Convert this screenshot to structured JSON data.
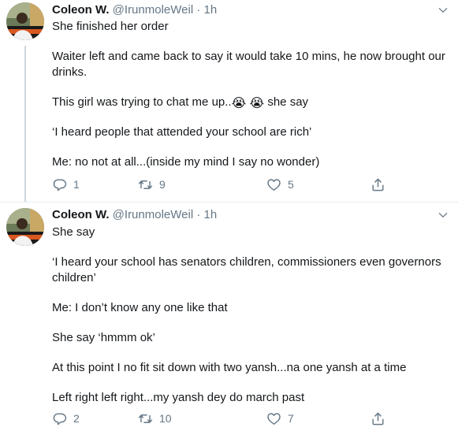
{
  "tweets": [
    {
      "author": "Coleon W.",
      "handle": "@IrunmoleWeil",
      "time": "1h",
      "paragraphs": [
        "She finished her order",
        "Waiter left and came back to say it would take 10 mins, he now brought our drinks.",
        "This girl was trying to chat me up..",
        "‘I heard people that attended your school are rich’",
        "Me: no not at all...(inside my mind I say no wonder)"
      ],
      "emoji_tail": "she say",
      "emoji": "crying-face",
      "replies": "1",
      "retweets": "9",
      "likes": "5"
    },
    {
      "author": "Coleon W.",
      "handle": "@IrunmoleWeil",
      "time": "1h",
      "paragraphs": [
        "She say",
        "‘I heard your school has senators children, commissioners even governors children’",
        "Me: I don’t know any one like that",
        "She say ‘hmmm ok’",
        "At this point I no fit sit down with two yansh...na one yansh at a time",
        "Left right left right...my yansh dey do march past"
      ],
      "replies": "2",
      "retweets": "10",
      "likes": "7"
    }
  ],
  "colors": {
    "text": "#14171a",
    "muted": "#657786",
    "divider": "#e6ecf0",
    "thread": "#ccd6dd"
  }
}
